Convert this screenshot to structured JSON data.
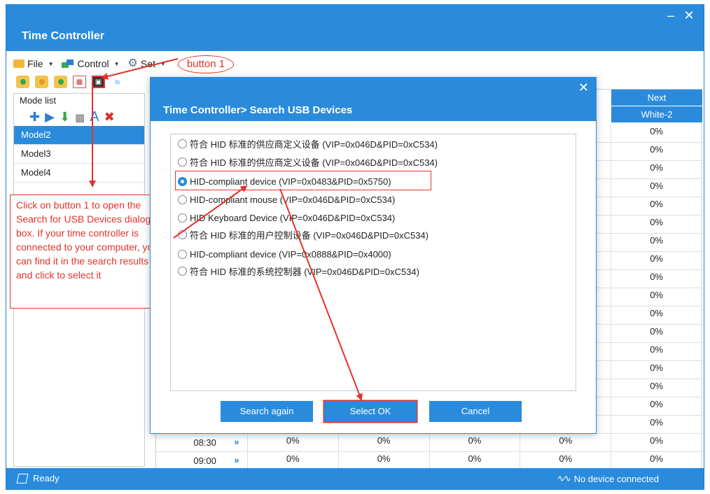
{
  "app": {
    "title": "Time Controller",
    "minimize": "‒",
    "close": "✕"
  },
  "menu": {
    "file": "File",
    "control": "Control",
    "set": "Set"
  },
  "annotations": {
    "button_label": "button 1",
    "instructions": "Click on button 1 to open the Search for USB Devices dialog box. If your time controller is connected to your computer, you can find it in the search results and click to select it"
  },
  "mode_list": {
    "legend": "Mode list",
    "items": [
      "Model2",
      "Model3",
      "Model4"
    ],
    "selected": "Model2"
  },
  "grid": {
    "header_1": "Next",
    "header_2": "White-2",
    "visible_values": [
      "0%",
      "0%",
      "0%",
      "0%",
      "0%",
      "0%",
      "0%",
      "0%",
      "0%",
      "0%",
      "0%",
      "0%",
      "0%",
      "0%",
      "0%",
      "0%",
      "0%"
    ],
    "rows": [
      {
        "time": "08:30",
        "values": [
          "0%",
          "0%",
          "0%",
          "0%",
          "0%"
        ]
      },
      {
        "time": "09:00",
        "values": [
          "0%",
          "0%",
          "0%",
          "0%",
          "0%"
        ]
      }
    ]
  },
  "status": {
    "left": "Ready",
    "right": "No device connected"
  },
  "dialog": {
    "title": "Time Controller> Search USB Devices",
    "close": "✕",
    "devices": [
      {
        "label": "符合 HID 标准的供应商定义设备  (VIP=0x046D&PID=0xC534)",
        "selected": false
      },
      {
        "label": "符合 HID 标准的供应商定义设备  (VIP=0x046D&PID=0xC534)",
        "selected": false
      },
      {
        "label": "HID-compliant device  (VIP=0x0483&PID=0x5750)",
        "selected": true
      },
      {
        "label": "HID-compliant mouse  (VIP=0x046D&PID=0xC534)",
        "selected": false
      },
      {
        "label": "HID Keyboard Device  (VIP=0x046D&PID=0xC534)",
        "selected": false
      },
      {
        "label": "符合 HID 标准的用户控制设备  (VIP=0x046D&PID=0xC534)",
        "selected": false
      },
      {
        "label": "HID-compliant device  (VIP=0x0888&PID=0x4000)",
        "selected": false
      },
      {
        "label": "符合 HID 标准的系统控制器  (VIP=0x046D&PID=0xC534)",
        "selected": false
      }
    ],
    "buttons": {
      "search_again": "Search again",
      "select_ok": "Select OK",
      "cancel": "Cancel"
    }
  },
  "colors": {
    "accent": "#2a8bdc",
    "annotation": "#e2332b"
  }
}
